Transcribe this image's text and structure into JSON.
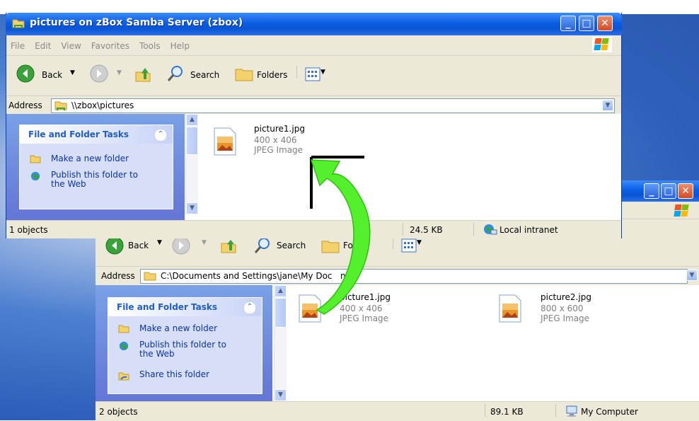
{
  "front_window": {
    "title": "pictures on zBox Samba Server (zbox)",
    "menu": [
      "File",
      "Edit",
      "View",
      "Favorites",
      "Tools",
      "Help"
    ],
    "toolbar": {
      "back_label": "Back",
      "search_label": "Search",
      "folders_label": "Folders"
    },
    "address": {
      "label": "Address",
      "value": "\\\\zbox\\pictures"
    },
    "task_pane": {
      "heading": "File and Folder Tasks",
      "items": [
        "Make a new folder",
        "Publish this folder to\nthe Web"
      ]
    },
    "files": [
      {
        "name": "picture1.jpg",
        "dimensions": "400 x 406",
        "type": "JPEG Image"
      }
    ],
    "status": {
      "objects": "1 objects",
      "size": "24.5 KB",
      "zone": "Local intranet"
    }
  },
  "back_window": {
    "toolbar": {
      "back_label": "Back",
      "search_label": "Search",
      "folders_label": "Fo"
    },
    "address": {
      "label": "Address",
      "value": "C:\\Documents and Settings\\jane\\My Doc",
      "value_tail": "nts"
    },
    "task_pane": {
      "heading": "File and Folder Tasks",
      "items": [
        "Make a new folder",
        "Publish this folder to\nthe Web",
        "Share this folder"
      ]
    },
    "files": [
      {
        "name": "picture1.jpg",
        "dimensions": "400 x 406",
        "type": "JPEG Image"
      },
      {
        "name": "picture2.jpg",
        "dimensions": "800 x 600",
        "type": "JPEG Image"
      }
    ],
    "status": {
      "objects": "2 objects",
      "size": "89.1 KB",
      "zone": "My Computer"
    }
  },
  "icons": [
    "folder-icon",
    "back-arrow-icon",
    "forward-arrow-icon",
    "up-folder-icon",
    "search-icon",
    "folders-icon",
    "views-icon",
    "windows-flag-icon",
    "globe-icon",
    "jpeg-file-icon",
    "local-intranet-icon",
    "my-computer-icon",
    "share-folder-icon"
  ],
  "colors": {
    "titlebar": "#0a5ee3",
    "task_link": "#0c32a8",
    "task_heading": "#215dc6",
    "drag_arrow": "#55f02c"
  }
}
